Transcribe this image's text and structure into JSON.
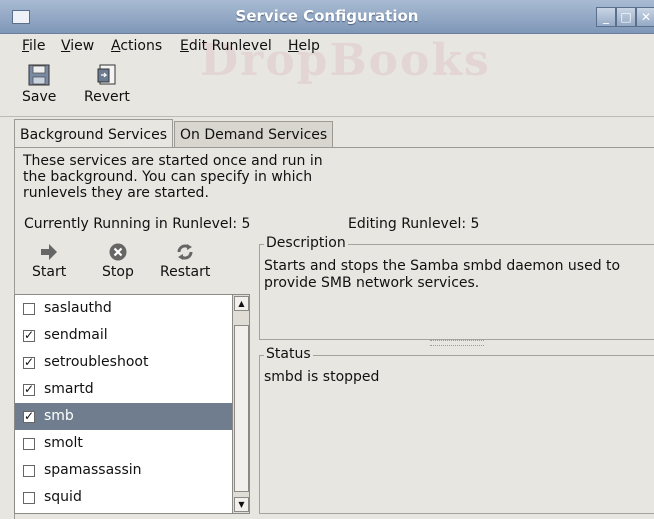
{
  "window": {
    "title": "Service Configuration"
  },
  "menu": [
    "File",
    "View",
    "Actions",
    "Edit Runlevel",
    "Help"
  ],
  "toolbar": {
    "save_label": "Save",
    "revert_label": "Revert"
  },
  "tabs": [
    {
      "label": "Background Services",
      "active": true
    },
    {
      "label": "On Demand Services",
      "active": false
    }
  ],
  "intro_text": "These services are started once and run in the background. You can specify in which runlevels they are started.",
  "runlevel": {
    "current": "Currently Running in Runlevel: 5",
    "editing": "Editing Runlevel: 5"
  },
  "service_toolbar": {
    "start_label": "Start",
    "stop_label": "Stop",
    "restart_label": "Restart"
  },
  "services": [
    {
      "name": "saslauthd",
      "checked": false,
      "selected": false
    },
    {
      "name": "sendmail",
      "checked": true,
      "selected": false
    },
    {
      "name": "setroubleshoot",
      "checked": true,
      "selected": false
    },
    {
      "name": "smartd",
      "checked": true,
      "selected": false
    },
    {
      "name": "smb",
      "checked": true,
      "selected": true
    },
    {
      "name": "smolt",
      "checked": false,
      "selected": false
    },
    {
      "name": "spamassassin",
      "checked": false,
      "selected": false
    },
    {
      "name": "squid",
      "checked": false,
      "selected": false
    }
  ],
  "description": {
    "legend": "Description",
    "text": "Starts and stops the Samba smbd daemon used to provide SMB network services."
  },
  "status": {
    "legend": "Status",
    "text": "smbd is stopped"
  },
  "watermark": "DropBooks",
  "colors": {
    "titlebar": "#8ea3c2",
    "selection": "#6f7d8f"
  }
}
